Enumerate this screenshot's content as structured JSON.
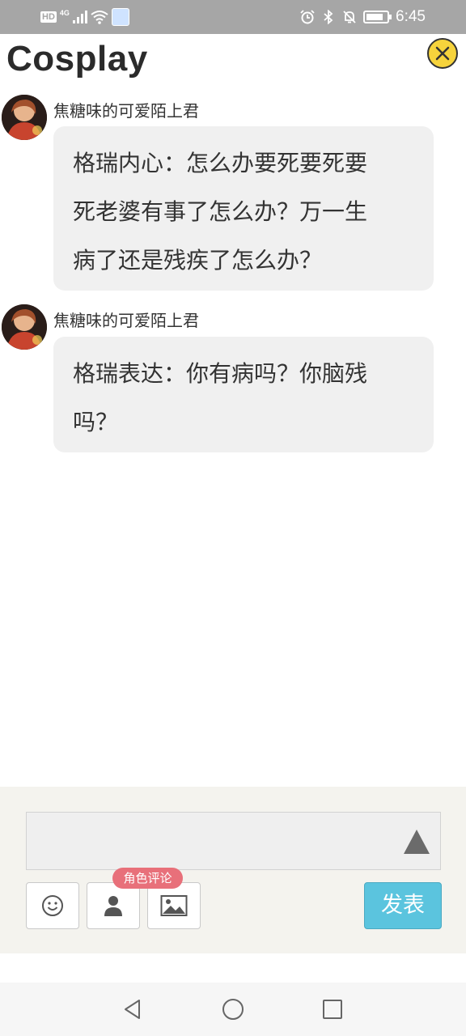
{
  "status_bar": {
    "hd": "HD",
    "network": "4G",
    "time": "6:45",
    "icons": [
      "signal-icon",
      "wifi-icon",
      "app-notification-icon",
      "alarm-icon",
      "bluetooth-icon",
      "mute-icon",
      "battery-icon"
    ]
  },
  "header": {
    "title": "Cosplay",
    "close_icon": "close-icon",
    "close_color": "#f6d33c"
  },
  "messages": [
    {
      "username": "焦糖味的可爱陌上君",
      "lines": [
        "格瑞内心：怎么办要死要死要",
        "死老婆有事了怎么办？万一生",
        "病了还是残疾了怎么办？"
      ]
    },
    {
      "username": "焦糖味的可爱陌上君",
      "lines": [
        "格瑞表达：你有病吗？你脑残",
        "吗？"
      ]
    }
  ],
  "composer": {
    "input_value": "",
    "expand_icon": "triangle-up-icon",
    "tools": [
      "emoji-icon",
      "person-icon",
      "image-icon"
    ],
    "role_badge": "角色评论",
    "send_label": "发表",
    "send_color": "#5bc4de",
    "badge_color": "#e8707a"
  },
  "nav_bar": {
    "icons": [
      "back-icon",
      "home-icon",
      "recents-icon"
    ]
  }
}
